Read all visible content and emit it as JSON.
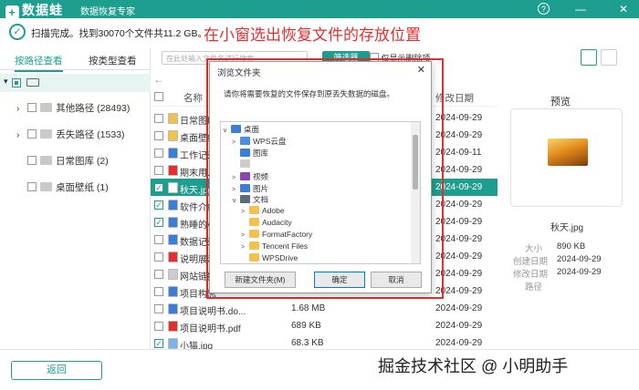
{
  "app": {
    "name": "数据蛙",
    "subtitle": "数据恢复专家",
    "help_glyph": "?",
    "min_glyph": "—",
    "close_glyph": "✕"
  },
  "status": {
    "scan_text": "扫描完成。找到30070个文件共11.2 GB。"
  },
  "annotation": "在小窗选出恢复文件的存放位置",
  "tabs": [
    "按路径查看",
    "按类型查看"
  ],
  "tree": {
    "root_label": "",
    "items": [
      {
        "label": "其他路径 (28493)"
      },
      {
        "label": "丢失路径 (1533)"
      },
      {
        "label": "日常图库 (2)"
      },
      {
        "label": "桌面壁纸 (1)"
      }
    ]
  },
  "toolbar": {
    "search_placeholder": "在此处输入文件名进行搜索",
    "filter_label": "筛选器",
    "show_deleted": "仅显示删除项"
  },
  "columns": {
    "name": "名称",
    "modified": "修改日期"
  },
  "rows": [
    {
      "name": "日常图库",
      "size": "",
      "date": "2024-09-29",
      "icon": "folder",
      "color": "#f2c14e",
      "checked": false
    },
    {
      "name": "桌面壁纸",
      "size": "",
      "date": "2024-09-29",
      "icon": "folder",
      "color": "#f2c14e",
      "checked": false
    },
    {
      "name": "工作记录",
      "size": "",
      "date": "2024-09-11",
      "icon": "doc",
      "color": "#3b7dd8",
      "checked": false
    },
    {
      "name": "期末用.pd",
      "size": "",
      "date": "2024-09-29",
      "icon": "pdf",
      "color": "#e3302f",
      "checked": false
    },
    {
      "name": "秋天.jpg",
      "size": "",
      "date": "2024-09-29",
      "icon": "img",
      "color": "#ffffff",
      "checked": true,
      "selected": true
    },
    {
      "name": "软件介绍",
      "size": "",
      "date": "2024-09-29",
      "icon": "doc",
      "color": "#3b7dd8",
      "checked": true
    },
    {
      "name": "熟睡的小猫",
      "size": "",
      "date": "2024-09-29",
      "icon": "doc",
      "color": "#3b7dd8",
      "checked": true
    },
    {
      "name": "数据记录表",
      "size": "",
      "date": "2024-09-29",
      "icon": "doc",
      "color": "#3b7dd8",
      "checked": false
    },
    {
      "name": "说明展示",
      "size": "",
      "date": "2024-09-29",
      "icon": "pdf",
      "color": "#e3302f",
      "checked": false
    },
    {
      "name": "网站链接",
      "size": "",
      "date": "2024-09-29",
      "icon": "doc",
      "color": "#cccccc",
      "checked": false
    },
    {
      "name": "项目构思",
      "size": "",
      "date": "2024-09-29",
      "icon": "doc",
      "color": "#3b7dd8",
      "checked": false
    },
    {
      "name": "项目说明书.do...",
      "size": "1.68 MB",
      "date": "2024-09-29",
      "icon": "doc",
      "color": "#3b7dd8",
      "checked": false
    },
    {
      "name": "项目说明书.pdf",
      "size": "689 KB",
      "date": "2024-09-29",
      "icon": "pdf",
      "color": "#e3302f",
      "checked": false
    },
    {
      "name": "小猫.jpg",
      "size": "68.3 KB",
      "date": "2024-09-29",
      "icon": "img",
      "color": "#7fb3e8",
      "checked": true
    }
  ],
  "preview": {
    "title": "预览",
    "filename": "秋天.jpg",
    "size_label": "大小",
    "size": "890 KB",
    "created_label": "创建日期",
    "created": "2024-09-29",
    "modified_label": "修改日期",
    "modified": "2024-09-29",
    "path_label": "路径"
  },
  "back_button": "返回",
  "watermark": "掘金技术社区 @ 小明助手",
  "dialog": {
    "title": "浏览文件夹",
    "close": "✕",
    "message": "请你将需要恢复的文件保存到原丢失数据的磁盘。",
    "tree": [
      {
        "label": "桌面",
        "level": 0,
        "icon": "#3b7dd8",
        "arrow": "∨"
      },
      {
        "label": "WPS云盘",
        "level": 1,
        "icon": "#4a90e2",
        "arrow": ">"
      },
      {
        "label": "图库",
        "level": 1,
        "icon": "#3b7dd8",
        "arrow": ""
      },
      {
        "label": "",
        "level": 1,
        "icon": "#cccccc",
        "arrow": ""
      },
      {
        "label": "视频",
        "level": 1,
        "icon": "#8e44ad",
        "arrow": ">"
      },
      {
        "label": "图片",
        "level": 1,
        "icon": "#3b7dd8",
        "arrow": ">"
      },
      {
        "label": "文档",
        "level": 1,
        "icon": "#5b6b7b",
        "arrow": "∨"
      },
      {
        "label": "Adobe",
        "level": 2,
        "icon": "#f2c14e",
        "arrow": ">"
      },
      {
        "label": "Audacity",
        "level": 2,
        "icon": "#f2c14e",
        "arrow": ""
      },
      {
        "label": "FormatFactory",
        "level": 2,
        "icon": "#f2c14e",
        "arrow": ">"
      },
      {
        "label": "Tencent Files",
        "level": 2,
        "icon": "#f2c14e",
        "arrow": ">"
      },
      {
        "label": "WPSDrive",
        "level": 2,
        "icon": "#f2c14e",
        "arrow": ""
      }
    ],
    "new_folder": "新建文件夹(M)",
    "ok": "确定",
    "cancel": "取消"
  }
}
